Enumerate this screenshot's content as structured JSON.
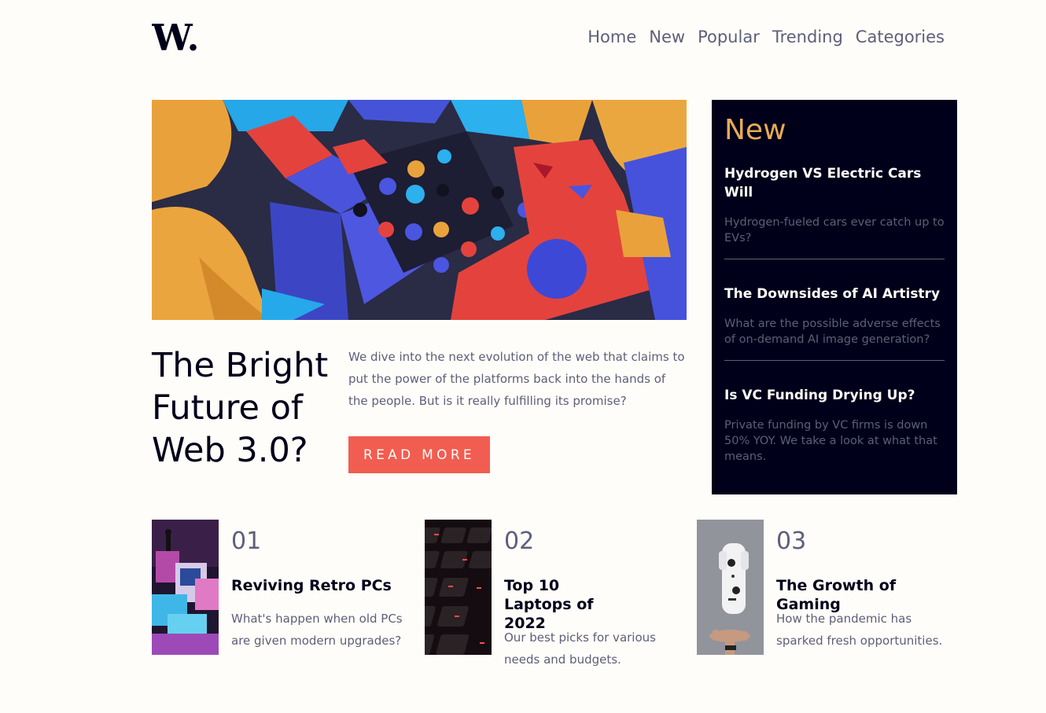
{
  "header": {
    "logo_text": "W.",
    "nav": [
      "Home",
      "New",
      "Popular",
      "Trending",
      "Categories"
    ]
  },
  "hero": {
    "title": "The Bright Future of Web 3.0?",
    "description": "We dive into the next evolution of the web that claims to put the power of the platforms back into the hands of the people. But is it really fulfilling its promise?",
    "button_label": "READ MORE"
  },
  "new_panel": {
    "heading": "New",
    "items": [
      {
        "title": "Hydrogen VS Electric Cars Will",
        "text": "Hydrogen-fueled cars ever catch up to EVs?"
      },
      {
        "title": "The Downsides of AI Artistry",
        "text": "What are the possible adverse effects of on-demand AI image generation?"
      },
      {
        "title": "Is VC Funding Drying Up?",
        "text": "Private funding by VC firms is down 50% YOY. We take a look at what that means."
      }
    ]
  },
  "cards": [
    {
      "number": "01",
      "title": "Reviving Retro PCs",
      "text": "What's happen when old PCs are given modern upgrades?"
    },
    {
      "number": "02",
      "title": "Top 10 Laptops of 2022",
      "text": "Our best picks for various needs and budgets."
    },
    {
      "number": "03",
      "title": "The Growth of Gaming",
      "text": "How the pandemic has sparked fresh opportunities."
    }
  ],
  "colors": {
    "background": "#fffdf9",
    "dark_navy": "#00001a",
    "grayish_blue": "#5d5f79",
    "soft_red": "#f15d51",
    "soft_orange": "#e9ab53"
  }
}
